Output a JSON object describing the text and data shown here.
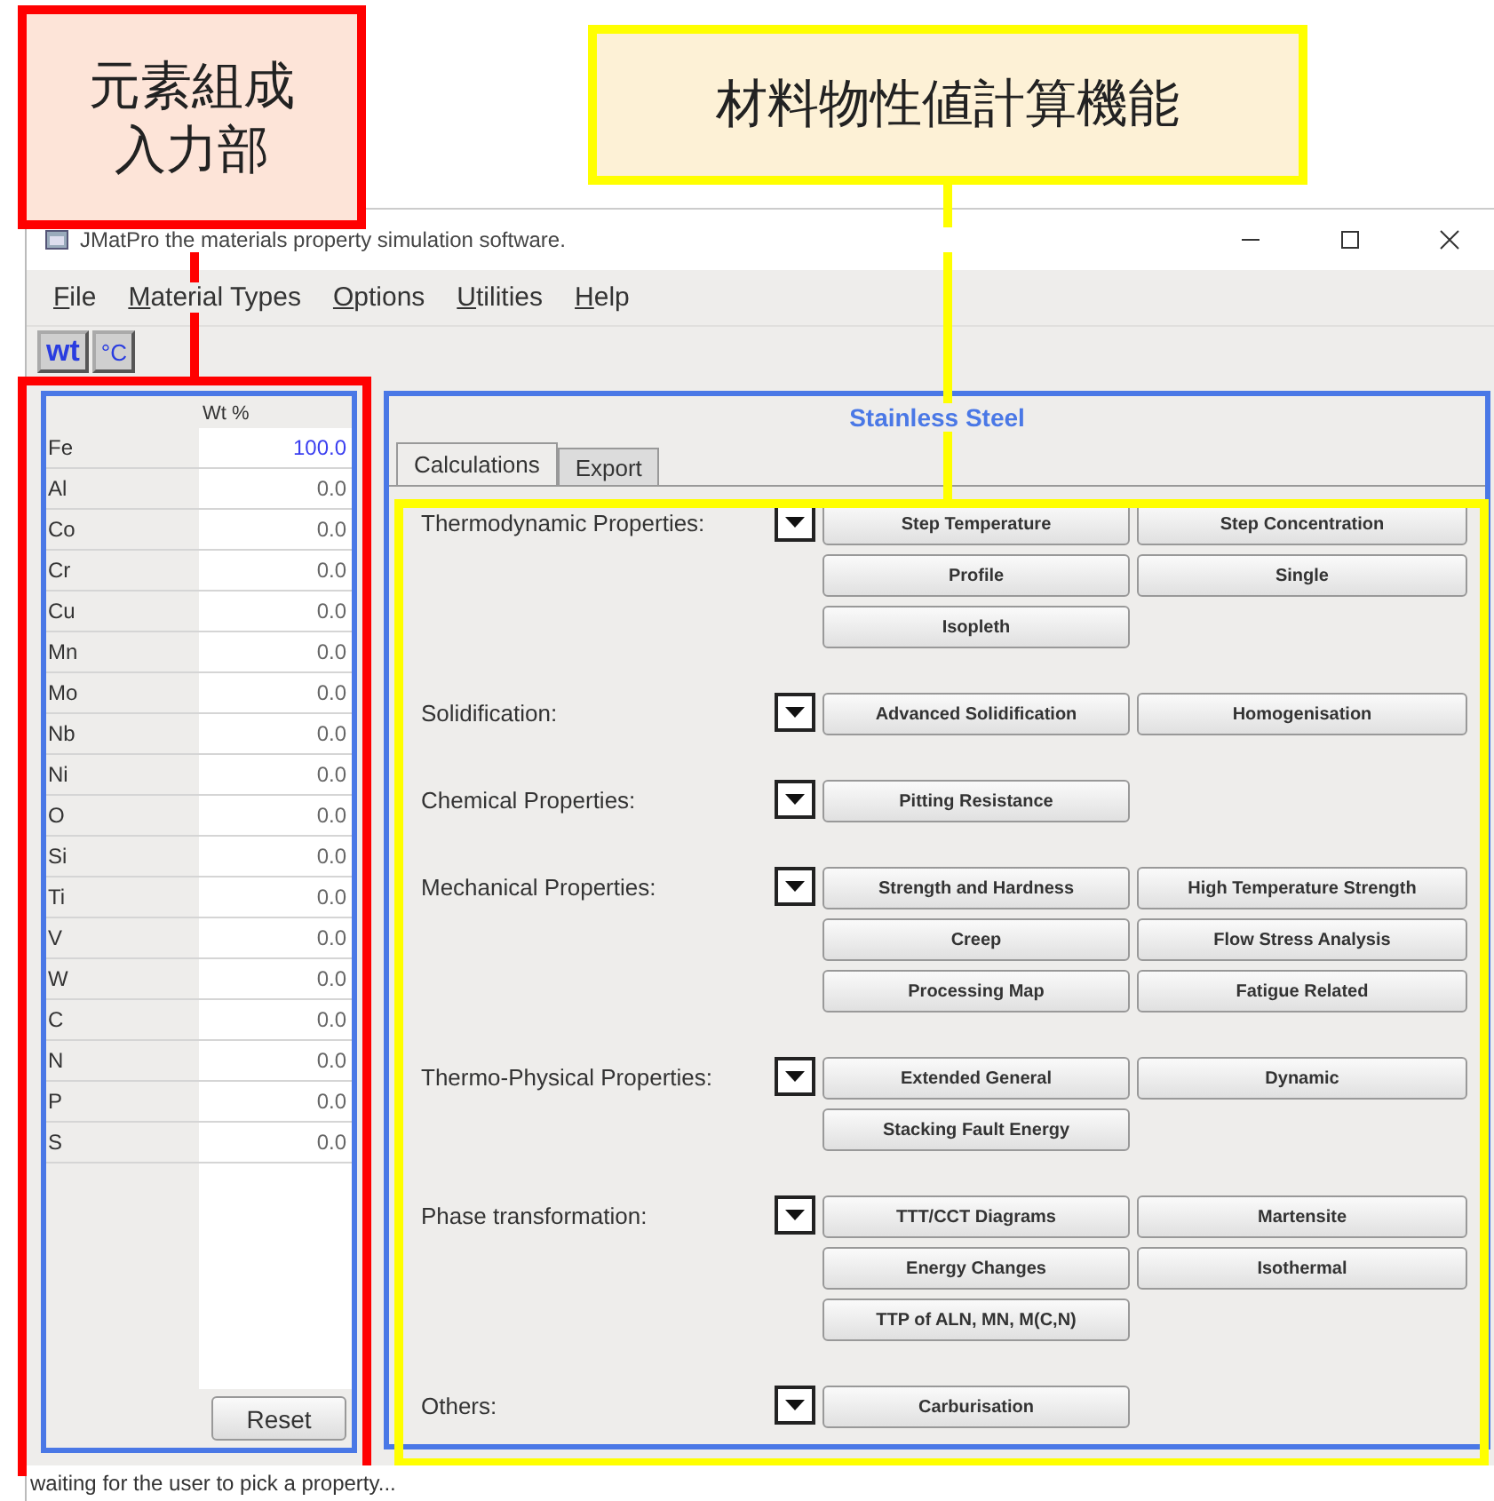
{
  "callouts": [
    {
      "lines": [
        "元素組成",
        "入力部"
      ],
      "color": "#ff0000"
    },
    {
      "lines": [
        "材料物性値計算機能"
      ],
      "color": "#ffff00"
    }
  ],
  "window": {
    "title": "JMatPro the materials property simulation software."
  },
  "menu": [
    "File",
    "Material Types",
    "Options",
    "Utilities",
    "Help"
  ],
  "toolbar": [
    {
      "label": "wt",
      "selected": true
    },
    {
      "label": "°C",
      "selected": false
    }
  ],
  "composition": {
    "header": "Wt %",
    "rows": [
      {
        "element": "Fe",
        "value": "100.0",
        "selected": true
      },
      {
        "element": "Al",
        "value": "0.0",
        "selected": false
      },
      {
        "element": "Co",
        "value": "0.0",
        "selected": false
      },
      {
        "element": "Cr",
        "value": "0.0",
        "selected": false
      },
      {
        "element": "Cu",
        "value": "0.0",
        "selected": false
      },
      {
        "element": "Mn",
        "value": "0.0",
        "selected": false
      },
      {
        "element": "Mo",
        "value": "0.0",
        "selected": false
      },
      {
        "element": "Nb",
        "value": "0.0",
        "selected": false
      },
      {
        "element": "Ni",
        "value": "0.0",
        "selected": false
      },
      {
        "element": "O",
        "value": "0.0",
        "selected": false
      },
      {
        "element": "Si",
        "value": "0.0",
        "selected": false
      },
      {
        "element": "Ti",
        "value": "0.0",
        "selected": false
      },
      {
        "element": "V",
        "value": "0.0",
        "selected": false
      },
      {
        "element": "W",
        "value": "0.0",
        "selected": false
      },
      {
        "element": "C",
        "value": "0.0",
        "selected": false
      },
      {
        "element": "N",
        "value": "0.0",
        "selected": false
      },
      {
        "element": "P",
        "value": "0.0",
        "selected": false
      },
      {
        "element": "S",
        "value": "0.0",
        "selected": false
      }
    ],
    "reset_button": "Reset"
  },
  "material_title": "Stainless Steel",
  "tabs": [
    {
      "label": "Calculations",
      "selected": true
    },
    {
      "label": "Export",
      "selected": false
    }
  ],
  "sections": [
    {
      "label": "Thermodynamic Properties:",
      "buttons": [
        "Step Temperature",
        "Step Concentration",
        "Profile",
        "Single",
        "Isopleth"
      ]
    },
    {
      "label": "Solidification:",
      "buttons": [
        "Advanced Solidification",
        "Homogenisation"
      ]
    },
    {
      "label": "Chemical Properties:",
      "buttons": [
        "Pitting Resistance"
      ]
    },
    {
      "label": "Mechanical Properties:",
      "buttons": [
        "Strength and Hardness",
        "High Temperature Strength",
        "Creep",
        "Flow Stress Analysis",
        "Processing Map",
        "Fatigue Related"
      ]
    },
    {
      "label": "Thermo-Physical Properties:",
      "buttons": [
        "Extended General",
        "Dynamic",
        "Stacking Fault Energy"
      ]
    },
    {
      "label": "Phase transformation:",
      "buttons": [
        "TTT/CCT Diagrams",
        "Martensite",
        "Energy Changes",
        "Isothermal",
        "TTP of ALN, MN, M(C,N)"
      ]
    },
    {
      "label": "Others:",
      "buttons": [
        "Carburisation"
      ]
    }
  ],
  "status_bar": "waiting for the user to pick a property..."
}
